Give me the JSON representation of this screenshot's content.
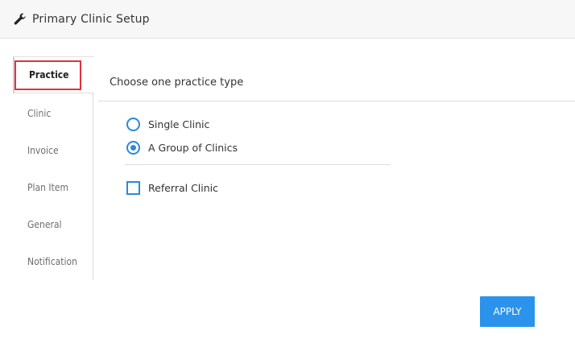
{
  "header": {
    "icon": "wrench-icon",
    "title": "Primary Clinic Setup"
  },
  "sidebar": {
    "items": [
      {
        "label": "Practice",
        "active": true
      },
      {
        "label": "Clinic",
        "active": false
      },
      {
        "label": "Invoice",
        "active": false
      },
      {
        "label": "Plan Item",
        "active": false
      },
      {
        "label": "General",
        "active": false
      },
      {
        "label": "Notification",
        "active": false
      }
    ]
  },
  "main": {
    "heading": "Choose one practice type",
    "options": [
      {
        "label": "Single Clinic",
        "type": "radio",
        "selected": false
      },
      {
        "label": "A Group of Clinics",
        "type": "radio",
        "selected": true
      }
    ],
    "referral": {
      "label": "Referral Clinic",
      "type": "checkbox",
      "checked": false
    },
    "apply_label": "APPLY"
  },
  "colors": {
    "accent": "#2a8ad8",
    "button": "#2b93ec",
    "highlight_box": "#e0333c"
  }
}
